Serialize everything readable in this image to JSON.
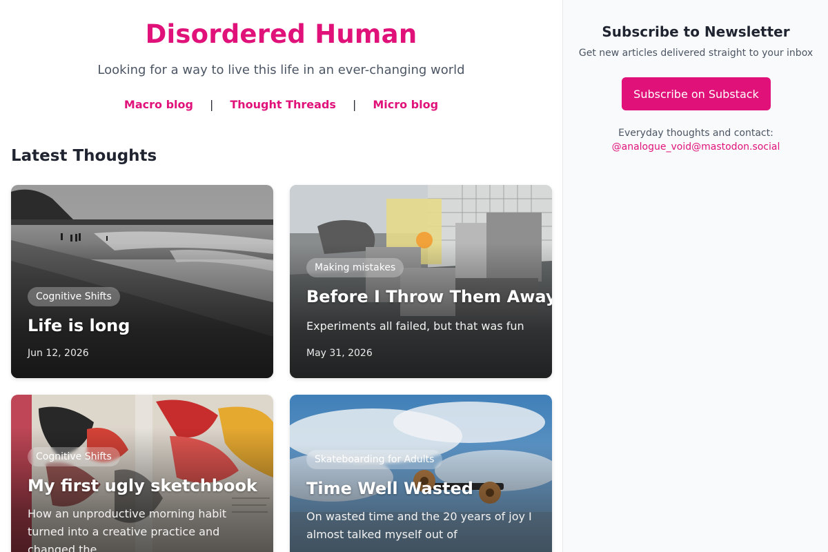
{
  "header": {
    "site_title": "Disordered Human",
    "tagline": "Looking for a way to live this life in an ever-changing world",
    "nav": [
      {
        "label": "Macro blog"
      },
      {
        "label": "Thought Threads"
      },
      {
        "label": "Micro blog"
      }
    ],
    "nav_separator": "|"
  },
  "main": {
    "section_title": "Latest Thoughts",
    "cards": [
      {
        "tag": "Cognitive Shifts",
        "title": "Life is long",
        "subtitle": "",
        "date": "Jun 12, 2026"
      },
      {
        "tag": "Making mistakes",
        "title": "Before I Throw Them Away",
        "subtitle": "Experiments all failed, but that was fun",
        "date": "May 31, 2026"
      },
      {
        "tag": "Cognitive Shifts",
        "title": "My first ugly sketchbook",
        "subtitle": "How an unproductive morning habit turned into a creative practice and changed the...",
        "date": ""
      },
      {
        "tag": "Skateboarding for Adults",
        "title": "Time Well Wasted",
        "subtitle": "On wasted time and the 20 years of joy I almost talked myself out of",
        "date": ""
      }
    ]
  },
  "sidebar": {
    "newsletter_title": "Subscribe to Newsletter",
    "newsletter_subtitle": "Get new articles delivered straight to your inbox",
    "subscribe_button": "Subscribe on Substack",
    "contact_label": "Everyday thoughts and contact:",
    "contact_handle": "@analogue_void@mastodon.social"
  },
  "colors": {
    "accent": "#e0127a",
    "text": "#1f2430",
    "muted": "#4b5563",
    "sidebar_bg": "#f9fafb"
  }
}
